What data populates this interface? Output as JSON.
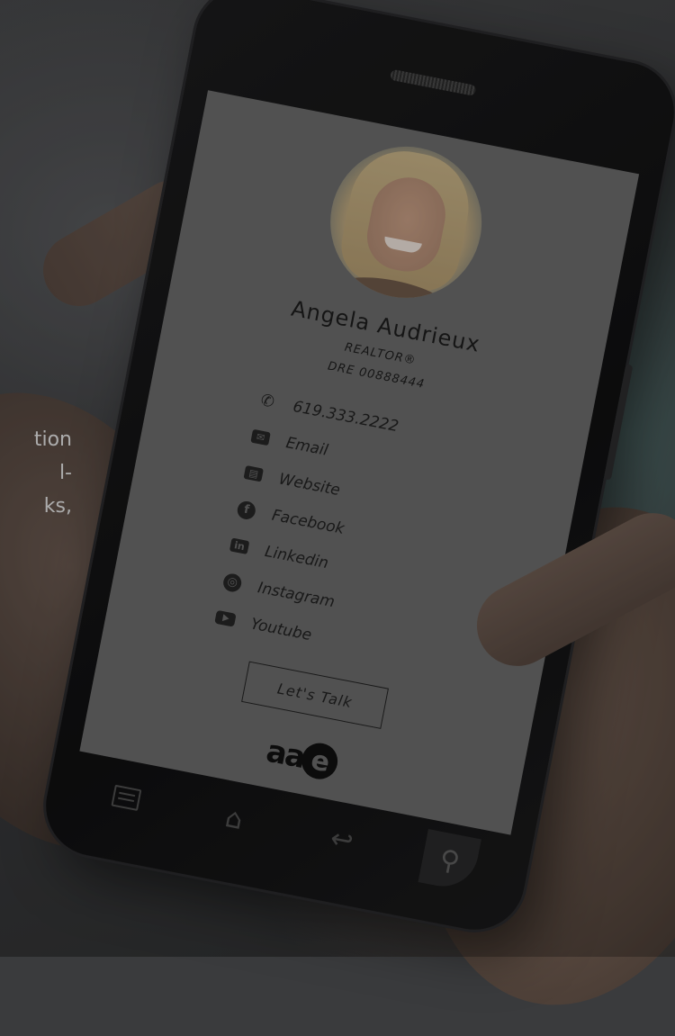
{
  "profile": {
    "name": "Angela Audrieux",
    "title": "REALTOR®",
    "license": "DRE 00888444"
  },
  "links": [
    {
      "label": "619.333.2222",
      "icon": "phone-icon"
    },
    {
      "label": "Email",
      "icon": "email-icon"
    },
    {
      "label": "Website",
      "icon": "website-icon"
    },
    {
      "label": "Facebook",
      "icon": "facebook-icon"
    },
    {
      "label": "Linkedin",
      "icon": "linkedin-icon"
    },
    {
      "label": "Instagram",
      "icon": "instagram-icon"
    },
    {
      "label": "Youtube",
      "icon": "youtube-icon"
    }
  ],
  "cta_label": "Let's Talk",
  "logo": {
    "text_a": "aa",
    "text_e": "e"
  },
  "nav": [
    {
      "icon": "menu-icon"
    },
    {
      "icon": "home-icon"
    },
    {
      "icon": "back-icon"
    },
    {
      "icon": "search-icon"
    }
  ],
  "side_text": [
    "tion",
    "l-",
    "ks,"
  ],
  "colors": {
    "screen": "#6d6d6d",
    "text": "#1d1d1d",
    "overlay_text": "#e6e6e6"
  }
}
